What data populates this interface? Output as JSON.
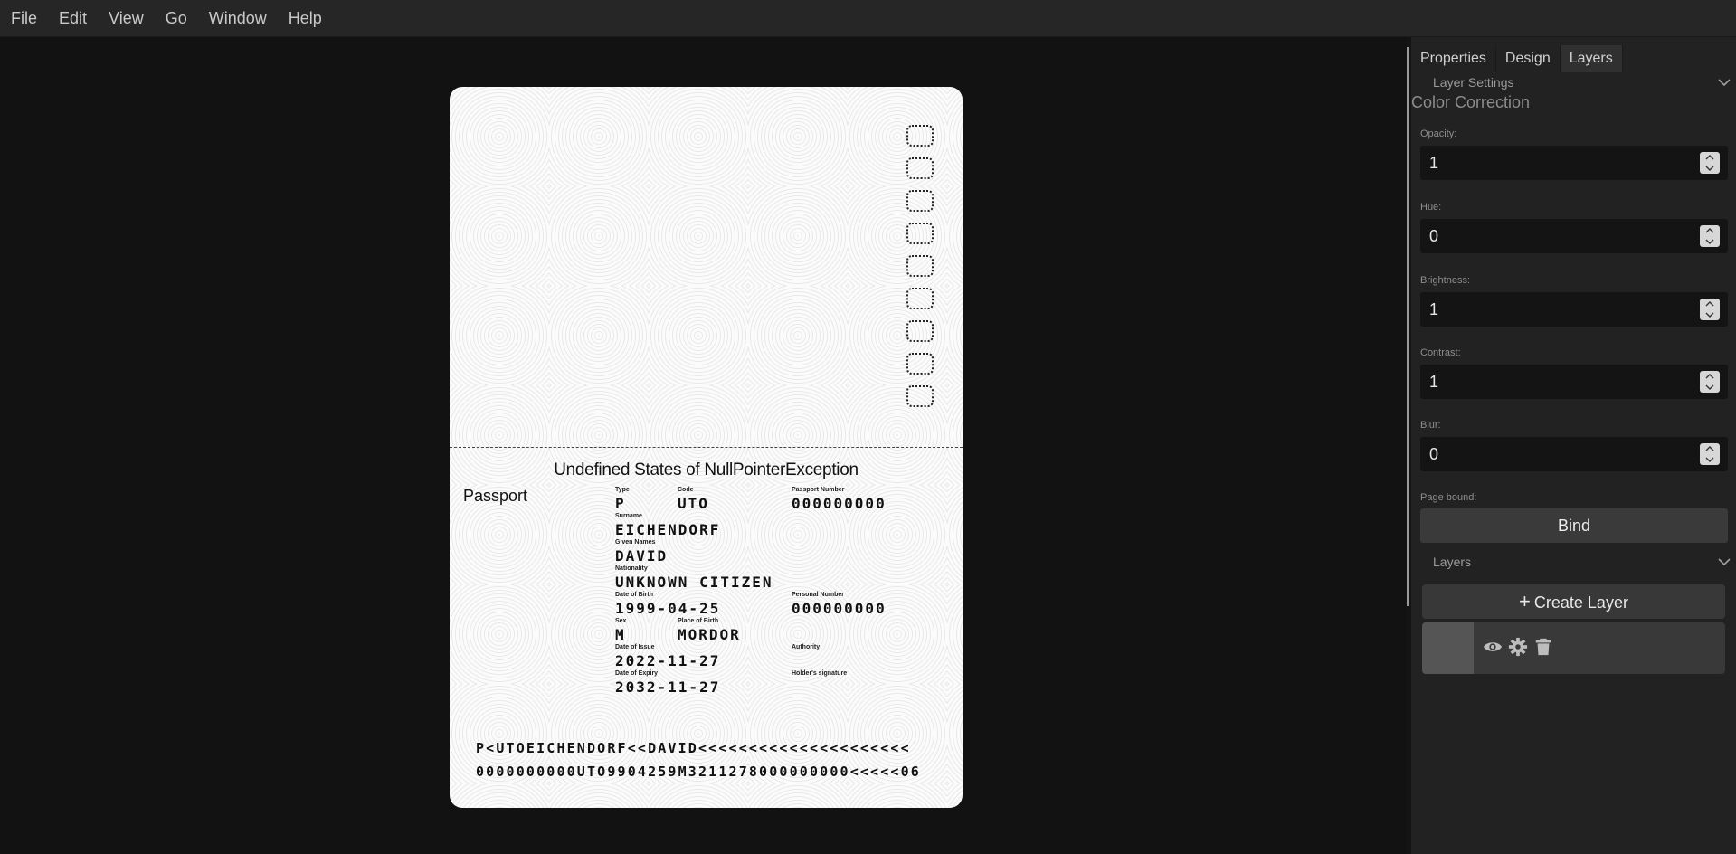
{
  "menubar": {
    "items": [
      "File",
      "Edit",
      "View",
      "Go",
      "Window",
      "Help"
    ]
  },
  "passport": {
    "country": "Undefined States of NullPointerException",
    "document_label": "Passport",
    "fields": {
      "type": {
        "label": "Type",
        "value": "P"
      },
      "code": {
        "label": "Code",
        "value": "UTO"
      },
      "passport_number": {
        "label": "Passport Number",
        "value": "000000000"
      },
      "surname": {
        "label": "Surname",
        "value": "EICHENDORF"
      },
      "given_names": {
        "label": "Given Names",
        "value": "DAVID"
      },
      "nationality": {
        "label": "Nationality",
        "value": "UNKNOWN CITIZEN"
      },
      "date_of_birth": {
        "label": "Date of Birth",
        "value": "1999-04-25"
      },
      "personal_number": {
        "label": "Personal Number",
        "value": "000000000"
      },
      "sex": {
        "label": "Sex",
        "value": "M"
      },
      "place_of_birth": {
        "label": "Place of Birth",
        "value": "MORDOR"
      },
      "date_of_issue": {
        "label": "Date of Issue",
        "value": "2022-11-27"
      },
      "authority": {
        "label": "Authority",
        "value": ""
      },
      "date_of_expiry": {
        "label": "Date of Expiry",
        "value": "2032-11-27"
      },
      "holder_signature": {
        "label": "Holder's signature",
        "value": ""
      }
    },
    "mrz": {
      "line1": "P<UTOEICHENDORF<<DAVID<<<<<<<<<<<<<<<<<<<<<",
      "line2": "0000000000UTO9904259M3211278000000000<<<<<06"
    }
  },
  "panel": {
    "tabs": [
      "Properties",
      "Design",
      "Layers"
    ],
    "active_tab": "Layers",
    "layer_settings_label": "Layer Settings",
    "color_correction_title": "Color Correction",
    "fields": {
      "opacity": {
        "label": "Opacity:",
        "value": "1"
      },
      "hue": {
        "label": "Hue:",
        "value": "0"
      },
      "brightness": {
        "label": "Brightness:",
        "value": "1"
      },
      "contrast": {
        "label": "Contrast:",
        "value": "1"
      },
      "blur": {
        "label": "Blur:",
        "value": "0"
      }
    },
    "page_bound_label": "Page bound:",
    "bind_label": "Bind",
    "layers_label": "Layers",
    "create_layer_label": "Create Layer",
    "layer_icons": [
      "eye-icon",
      "gear-icon",
      "trash-icon"
    ]
  },
  "colors": {
    "background": "#141414",
    "panel": "#222222",
    "input": "#141414",
    "accent_text": "#e6e6e6"
  }
}
